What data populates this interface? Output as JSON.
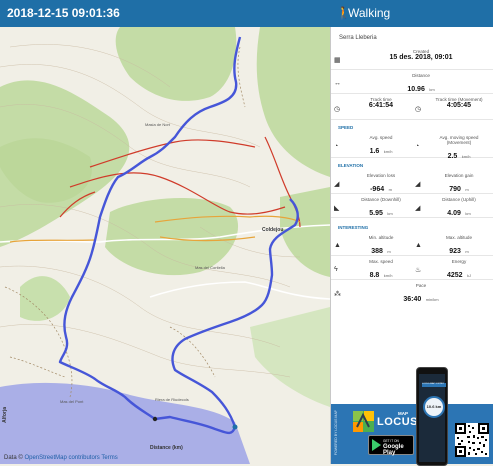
{
  "window": {
    "title": "2018-12-15 09:01:36",
    "activity": "Walking"
  },
  "map": {
    "attribution_prefix": "Data ©",
    "attribution_link": "OpenStreetMap contributors",
    "attribution_terms": "Terms",
    "labels": {
      "coldejou": "Coldejou",
      "distance_km": "Distance (km)",
      "alforja": "Alforja",
      "masia_nort": "Masia de Nort",
      "small1": "Mas del Cortiella",
      "small2": "Mas del Pont",
      "small3": "Riera de Riudecols"
    }
  },
  "stats": {
    "track_name": "Serra Lleberia",
    "created": {
      "label": "Created",
      "value": "15 des. 2018, 09:01"
    },
    "distance": {
      "label": "Distance",
      "value": "10.96",
      "unit": "km"
    },
    "track_time": {
      "label": "Track time",
      "value": "6:41:54"
    },
    "track_time_moving": {
      "label": "Track time (Movement)",
      "value": "4:05:45"
    },
    "section_speed": "SPEED",
    "avg_speed": {
      "label": "Avg. speed",
      "value": "1.6",
      "unit": "km/h"
    },
    "avg_moving_speed": {
      "label": "Avg. moving speed (Movement)",
      "value": "2.5",
      "unit": "km/h"
    },
    "section_elevation": "ELEVATION",
    "elev_loss": {
      "label": "Elevation loss",
      "value": "-964",
      "unit": "m"
    },
    "elev_gain": {
      "label": "Elevation gain",
      "value": "790",
      "unit": "m"
    },
    "dist_down": {
      "label": "Distance (Downhill)",
      "value": "5.95",
      "unit": "km"
    },
    "dist_up": {
      "label": "Distance (Uphill)",
      "value": "4.09",
      "unit": "km"
    },
    "section_interesting": "INTERESTING",
    "min_alt": {
      "label": "Min. altitude",
      "value": "388",
      "unit": "m"
    },
    "max_alt": {
      "label": "Max. altitude",
      "value": "923",
      "unit": "m"
    },
    "max_speed": {
      "label": "Max. speed",
      "value": "8.8",
      "unit": "km/h"
    },
    "energy": {
      "label": "Energy",
      "value": "4252",
      "unit": "kJ"
    },
    "pace": {
      "label": "Pace",
      "value": "36:40",
      "unit": "min/km"
    }
  },
  "ad": {
    "side_text": "POWERED BY LOCUS MAP",
    "map_word": "MAP",
    "locus_word": "LOCUS",
    "gp_small": "GET IT ON",
    "gp_big": "Google Play",
    "phone_title": "LOCUS MAP 3 INTRO",
    "phone_gauge": "10.6 km"
  },
  "colors": {
    "header": "#1f6fa7",
    "track": "#4656d8",
    "forest": "#b9d79a",
    "area": "#9ea3e6",
    "ad": "#2c75b4"
  },
  "icons": [
    "walking-icon",
    "calendar-icon",
    "ruler-icon",
    "clock-icon",
    "speed-icon",
    "elevation-icon",
    "slope-icon",
    "mountain-icon",
    "lightning-icon",
    "fire-icon",
    "footprints-icon"
  ]
}
